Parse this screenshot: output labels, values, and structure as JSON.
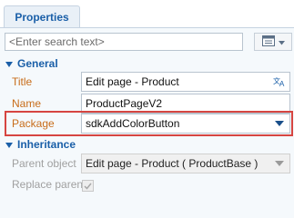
{
  "tabs": [
    {
      "label": "Properties"
    }
  ],
  "search": {
    "placeholder": "<Enter search text>",
    "value": ""
  },
  "toolbar": {
    "menu_icon": "list-icon"
  },
  "groups": {
    "general": {
      "label": "General",
      "properties": [
        {
          "label": "Title",
          "value": "Edit page - Product",
          "icon": "localize-icon"
        },
        {
          "label": "Name",
          "value": "ProductPageV2"
        },
        {
          "label": "Package",
          "value": "sdkAddColorButton",
          "icon": "dropdown-arrow-icon"
        }
      ]
    },
    "inheritance": {
      "label": "Inheritance",
      "properties": [
        {
          "label": "Parent object",
          "value": "Edit page - Product ( ProductBase )",
          "icon": "dropdown-arrow-icon"
        },
        {
          "label": "Replace parent",
          "checked": true
        }
      ]
    }
  },
  "colors": {
    "accent": "#1a5fa8",
    "label": "#c86d1a",
    "highlight": "#d64541",
    "disabled": "#a0a0a0"
  }
}
